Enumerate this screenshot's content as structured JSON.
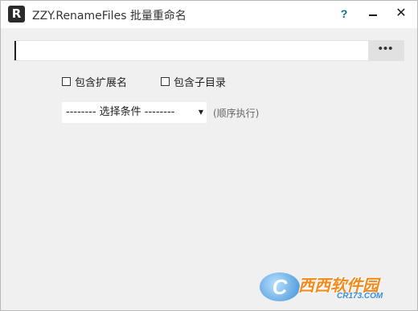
{
  "window": {
    "title": "ZZY.RenameFiles 批量重命名",
    "icon_letter": "R",
    "help_label": "?",
    "close_label": "✕"
  },
  "path": {
    "value": "",
    "browse_label": "•••"
  },
  "options": {
    "include_extension": {
      "label": "包含扩展名",
      "checked": false
    },
    "include_subdirs": {
      "label": "包含子目录",
      "checked": false
    }
  },
  "condition": {
    "selected": "-------- 选择条件 --------",
    "arrow": "▼",
    "hint": "(顺序执行)"
  },
  "watermark": {
    "badge": "C",
    "text": "西西软件园",
    "sub": "CR173.COM"
  }
}
